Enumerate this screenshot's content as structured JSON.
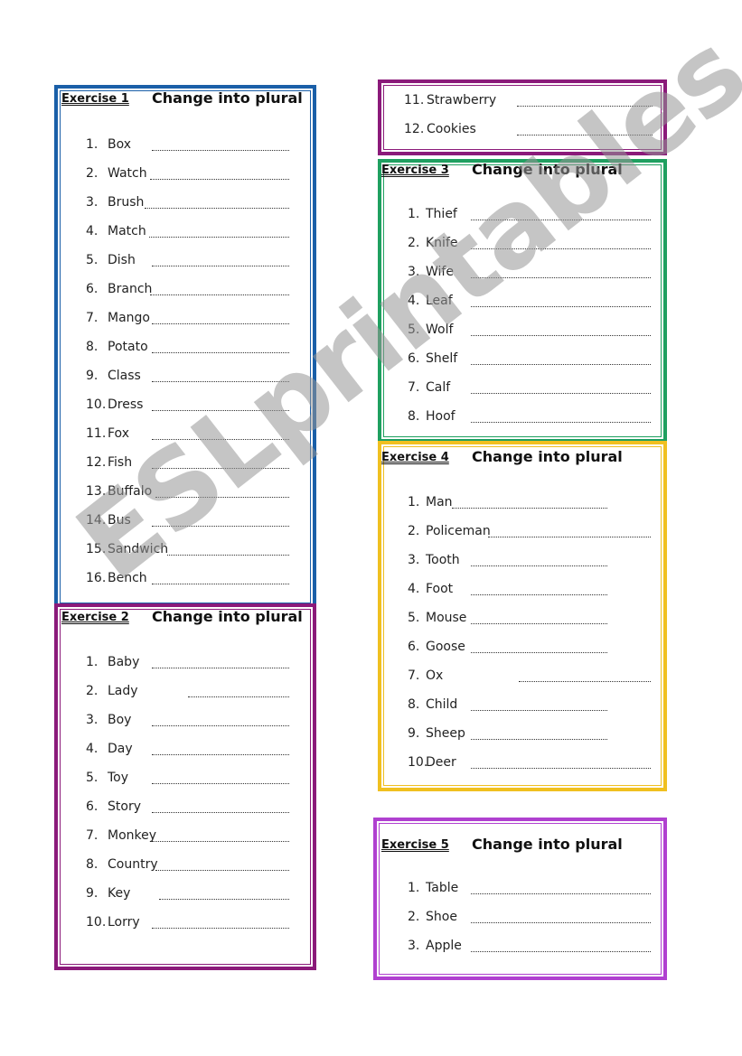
{
  "exercises": [
    {
      "label": "Exercise 1",
      "title": "Change into plural",
      "color": "#1a5fa8",
      "items": [
        {
          "num": "1.",
          "word": "Box"
        },
        {
          "num": "2.",
          "word": "Watch"
        },
        {
          "num": "3.",
          "word": "Brush"
        },
        {
          "num": "4.",
          "word": "Match"
        },
        {
          "num": "5.",
          "word": "Dish"
        },
        {
          "num": "6.",
          "word": "Branch"
        },
        {
          "num": "7.",
          "word": "Mango"
        },
        {
          "num": "8.",
          "word": "Potato"
        },
        {
          "num": "9.",
          "word": "Class"
        },
        {
          "num": "10.",
          "word": "Dress"
        },
        {
          "num": "11.",
          "word": "Fox"
        },
        {
          "num": "12.",
          "word": "Fish"
        },
        {
          "num": "13.",
          "word": "Buffalo"
        },
        {
          "num": "14.",
          "word": "Bus"
        },
        {
          "num": "15.",
          "word": "Sandwich"
        },
        {
          "num": "16.",
          "word": "Bench"
        }
      ]
    },
    {
      "label": "Exercise 2",
      "title": "Change into plural",
      "color": "#8b1a7a",
      "items": [
        {
          "num": "1.",
          "word": "Baby"
        },
        {
          "num": "2.",
          "word": "Lady"
        },
        {
          "num": "3.",
          "word": "Boy"
        },
        {
          "num": "4.",
          "word": "Day"
        },
        {
          "num": "5.",
          "word": "Toy"
        },
        {
          "num": "6.",
          "word": "Story"
        },
        {
          "num": "7.",
          "word": "Monkey"
        },
        {
          "num": "8.",
          "word": "Country"
        },
        {
          "num": "9.",
          "word": "Key"
        },
        {
          "num": "10.",
          "word": "Lorry"
        }
      ],
      "continued": [
        {
          "num": "11.",
          "word": "Strawberry"
        },
        {
          "num": "12.",
          "word": "Cookies"
        }
      ]
    },
    {
      "label": "Exercise 3",
      "title": "Change into plural",
      "color": "#1fa060",
      "items": [
        {
          "num": "1.",
          "word": "Thief"
        },
        {
          "num": "2.",
          "word": "Knife"
        },
        {
          "num": "3.",
          "word": "Wife"
        },
        {
          "num": "4.",
          "word": "Leaf"
        },
        {
          "num": "5.",
          "word": "Wolf"
        },
        {
          "num": "6.",
          "word": "Shelf"
        },
        {
          "num": "7.",
          "word": "Calf"
        },
        {
          "num": "8.",
          "word": "Hoof"
        }
      ]
    },
    {
      "label": "Exercise 4",
      "title": "Change into plural",
      "color": "#f0c020",
      "items": [
        {
          "num": "1.",
          "word": "Man"
        },
        {
          "num": "2.",
          "word": "Policeman"
        },
        {
          "num": "3.",
          "word": "Tooth"
        },
        {
          "num": "4.",
          "word": "Foot"
        },
        {
          "num": "5.",
          "word": "Mouse"
        },
        {
          "num": "6.",
          "word": "Goose"
        },
        {
          "num": "7.",
          "word": "Ox"
        },
        {
          "num": "8.",
          "word": "Child"
        },
        {
          "num": "9.",
          "word": "Sheep"
        },
        {
          "num": "10.",
          "word": "Deer"
        }
      ]
    },
    {
      "label": "Exercise 5",
      "title": "Change into plural",
      "color": "#b040d0",
      "items": [
        {
          "num": "1.",
          "word": "Table"
        },
        {
          "num": "2.",
          "word": "Shoe"
        },
        {
          "num": "3.",
          "word": "Apple"
        }
      ]
    }
  ],
  "watermark": "ESLprintables.com"
}
